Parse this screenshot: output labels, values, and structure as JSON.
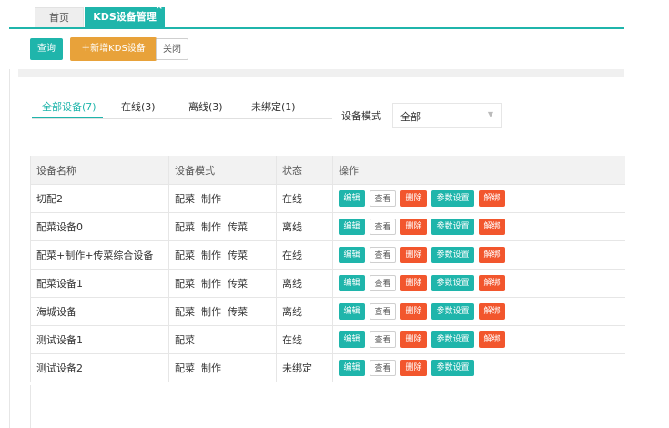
{
  "tabs": [
    {
      "label": "首页",
      "active": false
    },
    {
      "label": "KDS设备管理",
      "active": true,
      "close": "×"
    }
  ],
  "toolbar": {
    "query_label": "查询",
    "add_label": "＋新增KDS设备",
    "close_label": "关闭"
  },
  "status_tabs": [
    {
      "label": "全部设备(7)",
      "active": true
    },
    {
      "label": "在线(3)",
      "active": false
    },
    {
      "label": "离线(3)",
      "active": false
    },
    {
      "label": "未绑定(1)",
      "active": false
    }
  ],
  "filter": {
    "label": "设备模式",
    "value": "全部"
  },
  "table": {
    "headers": [
      "设备名称",
      "设备模式",
      "状态",
      "操作"
    ],
    "action_labels": {
      "edit": "编辑",
      "view": "查看",
      "delete": "删除",
      "params": "参数设置",
      "unbind": "解绑"
    },
    "rows": [
      {
        "name": "切配2",
        "mode": "配菜  制作",
        "status": "在线",
        "status_type": "online",
        "has_unbind": true
      },
      {
        "name": "配菜设备0",
        "mode": "配菜  制作  传菜",
        "status": "离线",
        "status_type": "offline",
        "has_unbind": true
      },
      {
        "name": "配菜+制作+传菜综合设备",
        "mode": "配菜  制作  传菜",
        "status": "在线",
        "status_type": "online",
        "has_unbind": true
      },
      {
        "name": "配菜设备1",
        "mode": "配菜  制作  传菜",
        "status": "离线",
        "status_type": "offline",
        "has_unbind": true
      },
      {
        "name": "海城设备",
        "mode": "配菜  制作  传菜",
        "status": "离线",
        "status_type": "offline",
        "has_unbind": true
      },
      {
        "name": "测试设备1",
        "mode": "配菜",
        "status": "在线",
        "status_type": "online",
        "has_unbind": true
      },
      {
        "name": "测试设备2",
        "mode": "配菜  制作",
        "status": "未绑定",
        "status_type": "unbound",
        "has_unbind": false
      }
    ]
  },
  "colors": {
    "accent": "#1fb5ab",
    "warning": "#e8a23a",
    "danger": "#f2562d",
    "online": "#3aa536",
    "unbound": "#e8443a"
  }
}
